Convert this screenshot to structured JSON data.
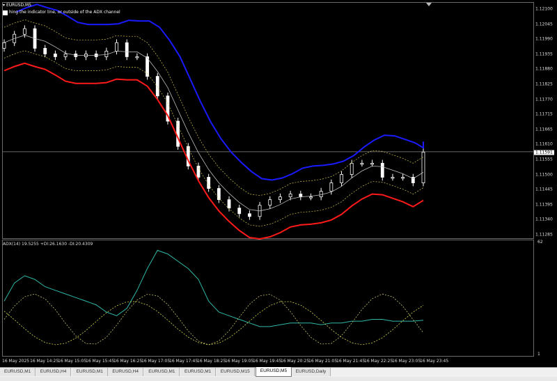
{
  "window": {
    "symbol_label": "EURUSD,M5",
    "hint_text": "hing the indicator line, or outside of the ADX channel"
  },
  "price_axis": {
    "ticks": [
      "1.12100",
      "1.12045",
      "1.11990",
      "1.11935",
      "1.11880",
      "1.11825",
      "1.11770",
      "1.11715",
      "1.11665",
      "1.11610",
      "1.11555",
      "1.11500",
      "1.11445",
      "1.11395",
      "1.11340",
      "1.11285"
    ],
    "current_price": "1.11591"
  },
  "adx_panel": {
    "label": "ADX(14) 19.5255 +DI:26.1630 -DI:20.4309",
    "top_value": "62",
    "bottom_value": "1"
  },
  "time_axis": {
    "ticks": [
      "16 May 2025",
      "16 May 14:25",
      "16 May 15:05",
      "16 May 15:45",
      "16 May 16:25",
      "16 May 17:05",
      "16 May 17:45",
      "16 May 18:25",
      "16 May 19:05",
      "16 May 19:45",
      "16 May 20:25",
      "16 May 21:05",
      "16 May 21:45",
      "16 May 22:25",
      "16 May 23:05",
      "16 May 23:45"
    ]
  },
  "tabs": [
    {
      "label": "EURUSD,M1",
      "active": false
    },
    {
      "label": "EURUSD,H4",
      "active": false
    },
    {
      "label": "EURUSD,M1",
      "active": false
    },
    {
      "label": "EURUSD,H4",
      "active": false
    },
    {
      "label": "EURUSD,M1",
      "active": false
    },
    {
      "label": "EURUSD,M1",
      "active": false
    },
    {
      "label": "EURUSD,M15",
      "active": false
    },
    {
      "label": "EURUSD,M5",
      "active": true
    },
    {
      "label": "EURUSD,Daily",
      "active": false
    }
  ],
  "colors": {
    "upper_band": "#1a1aff",
    "lower_band": "#ff1a1a",
    "middle_line": "#bfbfbf",
    "envelope": "#d6c84a",
    "adx_line": "#2fb8a8",
    "plus_di": "#c8c06a",
    "minus_di": "#d8d84a",
    "candle": "#ffffff"
  },
  "chart_data": {
    "type": "line",
    "series": [
      {
        "name": "close",
        "values": [
          1.1198,
          1.1201,
          1.1203,
          1.1196,
          1.1194,
          1.1193,
          1.1194,
          1.1193,
          1.1194,
          1.1193,
          1.1195,
          1.1198,
          1.1193,
          1.1193,
          1.1186,
          1.1179,
          1.117,
          1.1161,
          1.1154,
          1.115,
          1.1146,
          1.1142,
          1.1139,
          1.1137,
          1.1136,
          1.114,
          1.1142,
          1.1143,
          1.1144,
          1.1143,
          1.1143,
          1.1145,
          1.1148,
          1.1151,
          1.1155,
          1.1155,
          1.1155,
          1.115,
          1.115,
          1.115,
          1.1148,
          1.1159
        ]
      },
      {
        "name": "ADX",
        "values": [
          30,
          40,
          44,
          42,
          38,
          36,
          34,
          32,
          30,
          28,
          24,
          22,
          26,
          36,
          48,
          58,
          56,
          52,
          48,
          42,
          30,
          24,
          22,
          20,
          18,
          16,
          16,
          17,
          18,
          18,
          18,
          17,
          18,
          18,
          19,
          19,
          20,
          20,
          19,
          19,
          19,
          19.5
        ]
      }
    ]
  }
}
